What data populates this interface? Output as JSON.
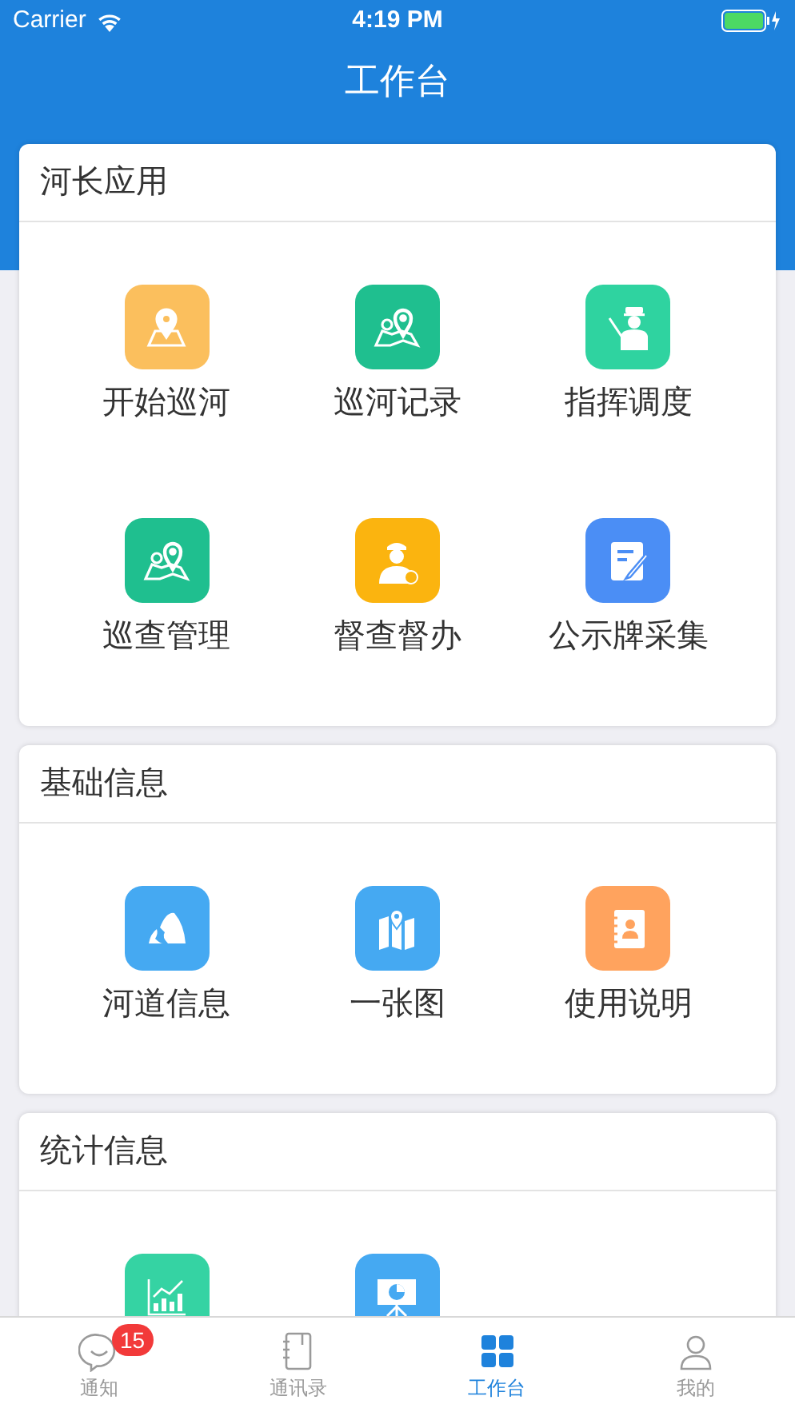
{
  "status_bar": {
    "carrier": "Carrier",
    "time": "4:19 PM"
  },
  "nav": {
    "title": "工作台"
  },
  "sections": [
    {
      "title": "河长应用",
      "items": [
        {
          "label": "开始巡河",
          "color": "#fbbf5d"
        },
        {
          "label": "巡河记录",
          "color": "#1fbf8f"
        },
        {
          "label": "指挥调度",
          "color": "#2fd3a0"
        },
        {
          "label": "巡查管理",
          "color": "#1fbf8f"
        },
        {
          "label": "督查督办",
          "color": "#fbb40f"
        },
        {
          "label": "公示牌采集",
          "color": "#4b8ef5"
        }
      ]
    },
    {
      "title": "基础信息",
      "items": [
        {
          "label": "河道信息",
          "color": "#45a9f2"
        },
        {
          "label": "一张图",
          "color": "#45a9f2"
        },
        {
          "label": "使用说明",
          "color": "#ffa35e"
        }
      ]
    },
    {
      "title": "统计信息",
      "items": [
        {
          "color": "#35d3a3"
        },
        {
          "color": "#45a9f2"
        }
      ]
    }
  ],
  "tabs": [
    {
      "label": "通知",
      "selected": false,
      "badge": "15"
    },
    {
      "label": "通讯录",
      "selected": false
    },
    {
      "label": "工作台",
      "selected": true
    },
    {
      "label": "我的",
      "selected": false
    }
  ]
}
